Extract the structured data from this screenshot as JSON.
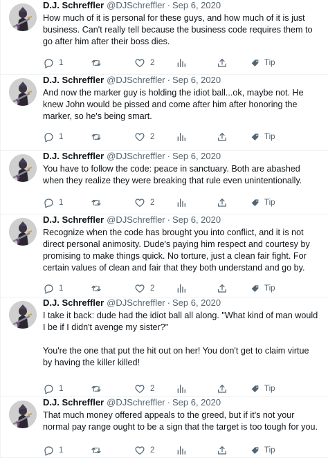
{
  "author": {
    "name": "D.J. Schreffler",
    "handle": "@DJSchreffler",
    "separator": "·"
  },
  "icons": {
    "reply": "reply-icon",
    "retweet": "retweet-icon",
    "like": "heart-icon",
    "views": "views-chart-icon",
    "share": "share-icon",
    "tip": "tip-icon"
  },
  "colors": {
    "text": "#0f1419",
    "muted": "#536471",
    "divider": "#eff3f4"
  },
  "tweets": [
    {
      "date": "Sep 6, 2020",
      "text": "How much of it is personal for these guys, and how much of it is just business. Can't really tell because the business code requires them to go after him after their boss dies.",
      "replies": "1",
      "likes": "2",
      "tip_label": "Tip"
    },
    {
      "date": "Sep 6, 2020",
      "text": "And now the marker guy is holding the idiot ball...ok, maybe not. He knew John would be pissed and come after him after honoring the marker, so he's being smart.",
      "replies": "1",
      "likes": "2",
      "tip_label": "Tip"
    },
    {
      "date": "Sep 6, 2020",
      "text": "You have to follow the code: peace in sanctuary. Both are abashed when they realize they were breaking that rule even unintentionally.",
      "replies": "1",
      "likes": "2",
      "tip_label": "Tip"
    },
    {
      "date": "Sep 6, 2020",
      "text": "Recognize when the code has brought you into conflict, and it is not direct personal animosity. Dude's paying him respect and courtesy by promising to make things quick. No torture, just a clean fair fight. For certain values of clean and fair that they both understand and go by.",
      "replies": "1",
      "likes": "2",
      "tip_label": "Tip"
    },
    {
      "date": "Sep 6, 2020",
      "text": "I take it back: dude had the idiot ball all along. \"What kind of man would I be if I didn't avenge my sister?\"\n\nYou're the one that put the hit out on her! You don't get to claim virtue by having the killer killed!",
      "replies": "1",
      "likes": "2",
      "tip_label": "Tip"
    },
    {
      "date": "Sep 6, 2020",
      "text": "That much money offered appeals to the greed, but if it's not your normal pay range ought to be a sign that the target is too tough for you.",
      "replies": "1",
      "likes": "2",
      "tip_label": "Tip"
    }
  ]
}
